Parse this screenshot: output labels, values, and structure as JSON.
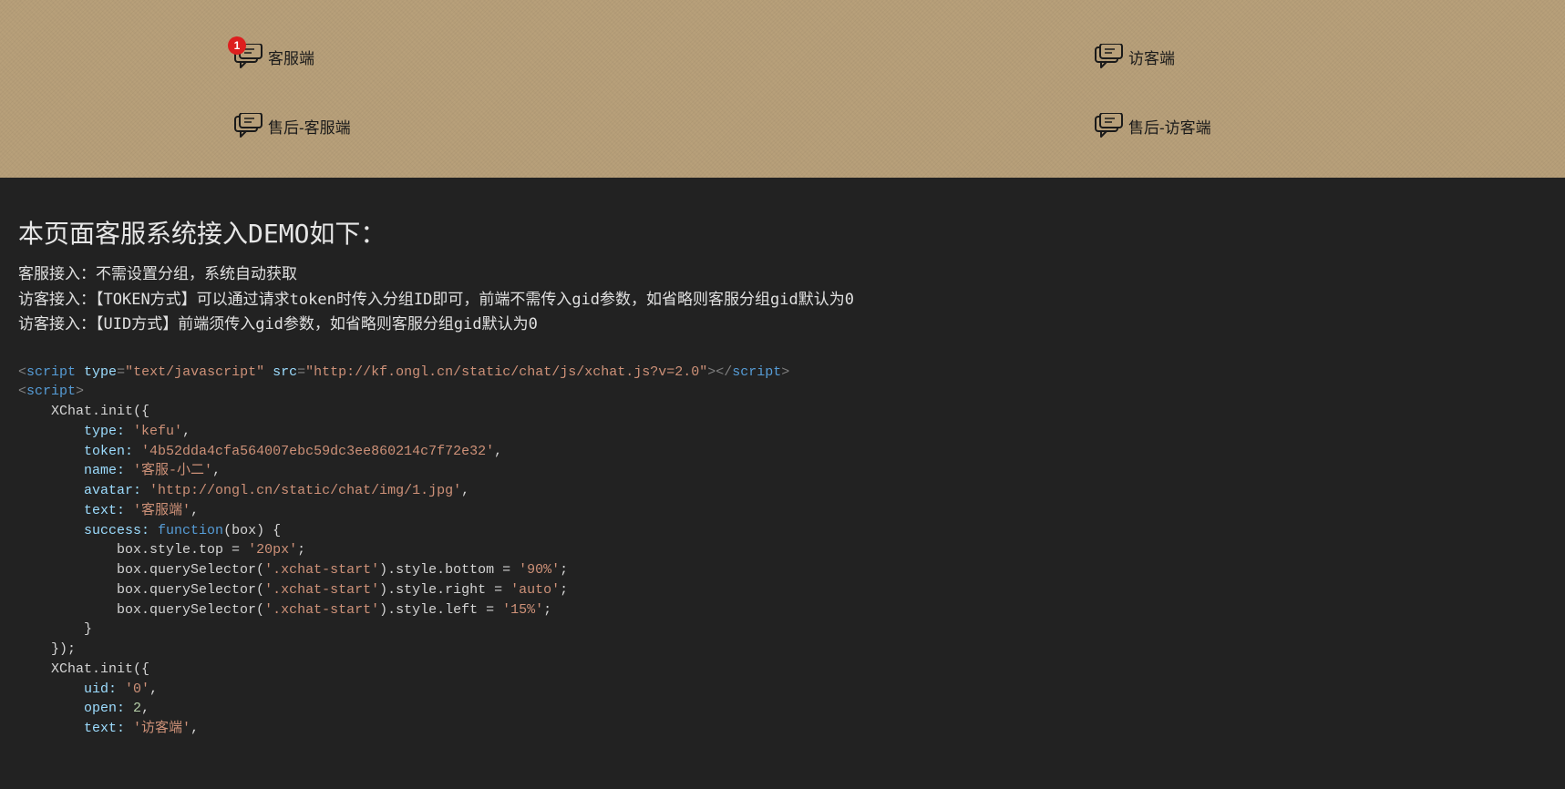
{
  "header": {
    "buttons": {
      "kefu": {
        "label": "客服端",
        "badge": "1"
      },
      "visitor": {
        "label": "访客端"
      },
      "saleKefu": {
        "label": "售后-客服端"
      },
      "saleVisitor": {
        "label": "售后-访客端"
      }
    }
  },
  "content": {
    "title": "本页面客服系统接入DEMO如下：",
    "desc1": "客服接入：不需设置分组，系统自动获取",
    "desc2": "访客接入：【TOKEN方式】可以通过请求token时传入分组ID即可，前端不需传入gid参数，如省略则客服分组gid默认为0",
    "desc3": "访客接入：【UID方式】前端须传入gid参数，如省略则客服分组gid默认为0"
  },
  "code": {
    "scriptTag": "script",
    "typeAttr": "type",
    "typeVal": "\"text/javascript\"",
    "srcAttr": "src",
    "srcVal": "\"http://kf.ongl.cn/static/chat/js/xchat.js?v=2.0\"",
    "initCall": "XChat.init({",
    "typeKey": "type:",
    "typeStr": "'kefu'",
    "tokenKey": "token:",
    "tokenStr": "'4b52dda4cfa564007ebc59dc3ee860214c7f72e32'",
    "nameKey": "name:",
    "nameStr": "'客服-小二'",
    "avatarKey": "avatar:",
    "avatarStr": "'http://ongl.cn/static/chat/img/1.jpg'",
    "textKey": "text:",
    "textStr1": "'客服端'",
    "successKey": "success:",
    "funcKw": "function",
    "funcParams": "(box) {",
    "line_top": "box.style.top = ",
    "val_top": "'20px'",
    "line_bottom": "box.querySelector(",
    "sel_start": "'.xchat-start'",
    "style_bottom": ").style.bottom = ",
    "val_bottom": "'90%'",
    "style_right": ").style.right = ",
    "val_right": "'auto'",
    "style_left": ").style.left = ",
    "val_left": "'15%'",
    "closeBrace": "}",
    "closeInit": "});",
    "uidKey": "uid:",
    "uidStr": "'0'",
    "openKey": "open:",
    "openVal": "2",
    "textStr2": "'访客端'"
  }
}
